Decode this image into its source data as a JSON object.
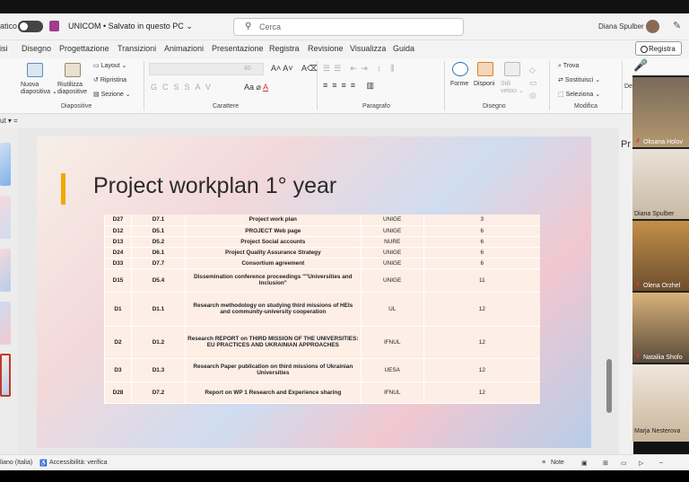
{
  "titlebar": {
    "autosave": "atico",
    "doc_title": "UNICOM • Salvato in questo PC ⌄",
    "search_placeholder": "Cerca",
    "user_name": "Diana Spulber"
  },
  "menu": {
    "items": [
      "isi",
      "Disegno",
      "Progettazione",
      "Transizioni",
      "Animazioni",
      "Presentazione",
      "Registra",
      "Revisione",
      "Visualizza",
      "Guida"
    ],
    "registra_button": "Registra"
  },
  "ribbon": {
    "nuova": "Nuova\ndiapositiva ⌄",
    "riutilizza": "Riutilizza\ndiapositive",
    "layout": "Layout ⌄",
    "ripristina": "Ripristina",
    "sezione": "Sezione ⌄",
    "group_diapositive": "Diapositive",
    "font_size": "40",
    "group_carattere": "Carattere",
    "group_paragrafo": "Paragrafo",
    "forme": "Forme",
    "disponi": "Disponi",
    "stili_veloci": "Stili\nveloci ⌄",
    "group_disegno": "Disegno",
    "trova": "Trova",
    "sostituisci": "Sostituisci ⌄",
    "seleziona": "Seleziona ⌄",
    "group_modifica": "Modifica",
    "dettatura": "De"
  },
  "subbar": {
    "text": "ut ▾   ="
  },
  "slide": {
    "title": "Project workplan 1° year",
    "rows": [
      {
        "d": "D27",
        "code": "D7.1",
        "title": "Project work plan",
        "lead": "UNIGE",
        "month": "3"
      },
      {
        "d": "D12",
        "code": "D5.1",
        "title": "PROJECT Web page",
        "lead": "UNIGE",
        "month": "6"
      },
      {
        "d": "D13",
        "code": "D5.2",
        "title": "Project Social accounts",
        "lead": "NURE",
        "month": "6"
      },
      {
        "d": "D24",
        "code": "D6.1",
        "title": "Project Quality Assurance Strategy",
        "lead": "UNIGE",
        "month": "6"
      },
      {
        "d": "D33",
        "code": "D7.7",
        "title": "Consortium agreement",
        "lead": "UNIGE",
        "month": "6"
      },
      {
        "d": "D15",
        "code": "D5.4",
        "title": "Dissemination conference proceedings \"\"Universities and Inclusion\"",
        "lead": "UNIGE",
        "month": "11"
      },
      {
        "d": "D1",
        "code": "D1.1",
        "title": "Research methodology on studying third missions of HEIs and community-university cooperation",
        "lead": "UL",
        "month": "12"
      },
      {
        "d": "D2",
        "code": "D1.2",
        "title": "Research REPORT on THIRD MISSION OF THE UNIVERSITIES: EU PRACTICES AND UKRAINIAN APPROACHES",
        "lead": "IFNUL",
        "month": "12"
      },
      {
        "d": "D3",
        "code": "D1.3",
        "title": "Research Paper publication on third missions of Ukrainian Universities",
        "lead": "UESA",
        "month": "12"
      },
      {
        "d": "D28",
        "code": "D7.2",
        "title": "Report on WP 1 Research and Experience sharing",
        "lead": "IFNUL",
        "month": "12"
      }
    ]
  },
  "right_panel": {
    "label": "Pr",
    "thumb_caption": "Project"
  },
  "video": {
    "participants": [
      "Oksana Holov",
      "Diana Spulber",
      "Olena Orzhel",
      "Nataliia Shofo",
      "Marja Nesterova"
    ]
  },
  "status": {
    "language": "liano (Italia)",
    "accessibility": "Accessibilità: verifica",
    "notes": "Note"
  }
}
